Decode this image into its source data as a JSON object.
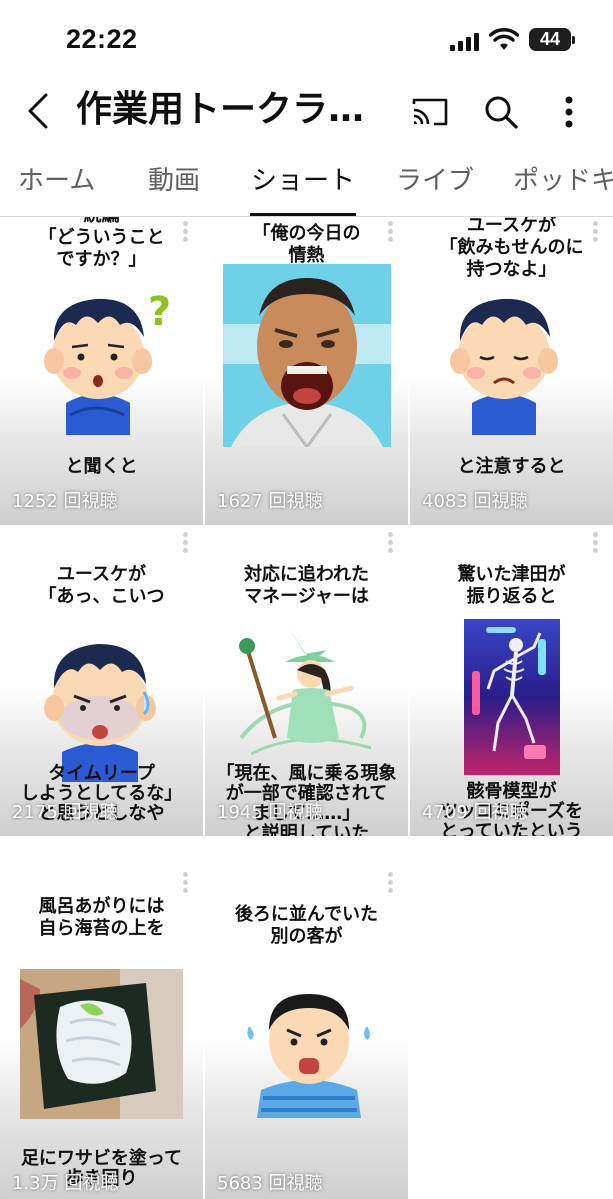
{
  "status_bar": {
    "time": "22:22",
    "battery": "44"
  },
  "header": {
    "title": "作業用トークラ…"
  },
  "tabs": [
    {
      "label": "ホーム"
    },
    {
      "label": "動画"
    },
    {
      "label": "ショート"
    },
    {
      "label": "ライブ"
    },
    {
      "label": "ポッドキ"
    }
  ],
  "active_tab": "ショート",
  "shorts": [
    {
      "top_text": [
        "続編",
        "「どういうこと",
        "ですか？」"
      ],
      "bottom_text": [
        "と聞くと"
      ],
      "views": "1252 回視聴"
    },
    {
      "top_text": [
        "「俺の今日の",
        "情熱"
      ],
      "bottom_text": [],
      "views": "1627 回視聴"
    },
    {
      "top_text": [
        "ユースケが",
        "「飲みもせんのに",
        "持つなよ」"
      ],
      "bottom_text": [
        "と注意すると"
      ],
      "views": "4083 回視聴"
    },
    {
      "top_text": [
        "ユースケが",
        "「あっ、こいつ"
      ],
      "bottom_text": [
        "タイムリープ",
        "しようとしてるな」",
        "と思うとしなや"
      ],
      "views": "2175 回視聴"
    },
    {
      "top_text": [
        "対応に追われた",
        "マネージャーは"
      ],
      "bottom_text": [
        "「現在、風に乗る現象",
        "が一部で確認されて",
        "まして……」",
        "と説明していた"
      ],
      "views": "1945 回視聴"
    },
    {
      "top_text": [
        "驚いた津田が",
        "振り返ると"
      ],
      "bottom_text": [
        "骸骨模型が",
        "ツッコミポーズを",
        "とっていたという"
      ],
      "views": "4709 回視聴"
    },
    {
      "top_text": [
        "風呂あがりには",
        "自ら海苔の上を"
      ],
      "bottom_text": [
        "足にワサビを塗って",
        "歩き回り"
      ],
      "views": "1.3万 回視聴"
    },
    {
      "top_text": [
        "後ろに並んでいた",
        "別の客が"
      ],
      "bottom_text": [],
      "views": "5683 回視聴"
    }
  ]
}
